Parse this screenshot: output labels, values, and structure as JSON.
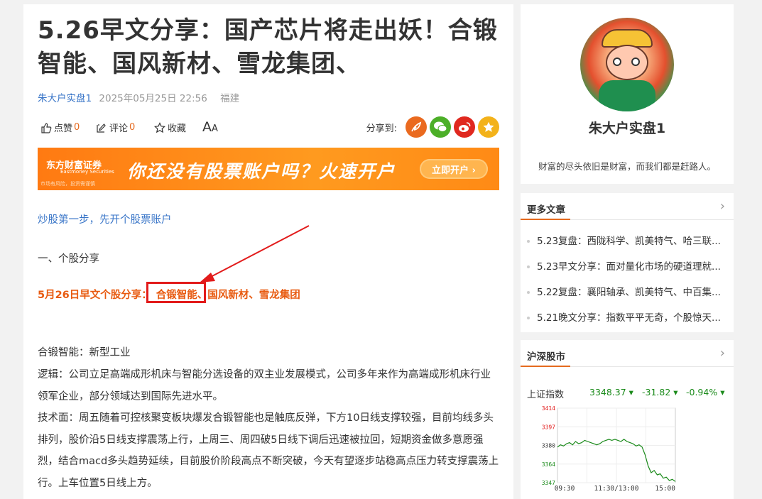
{
  "article": {
    "title_line1": "5.26早文分享：国产芯片将走出妖！合锻",
    "title_line2": "智能、国风新材、雪龙集团、",
    "author": "朱大户实盘1",
    "date": "2025年05月25日 22:56",
    "location": "福建",
    "like_label": "点赞",
    "like_count": "0",
    "comment_label": "评论",
    "comment_count": "0",
    "favorite_label": "收藏",
    "fontsize_label": "A",
    "fontsize_small": "A",
    "share_label": "分享到:",
    "link_text": "炒股第一步，先开个股票账户",
    "section1": "一、个股分享",
    "red_prefix": "5月26日早文个股分享：",
    "red_highlight": "合锻智能、",
    "red_rest": "国风新材、雪龙集团",
    "p_industry": "合锻智能：新型工业",
    "p_logic": "逻辑：公司立足高端成形机床与智能分选设备的双主业发展模式，公司多年来作为高端成形机床行业领军企业，部分领域达到国际先进水平。",
    "p_tech": "技术面：周五随着可控核聚变板块爆发合锻智能也是触底反弹，下方10日线支撑较强，目前均线多头排列，股价沿5日线支撑震荡上行，上周三、周四破5日线下调后迅速被拉回，短期资金做多意愿强烈，结合macd多头趋势延续，目前股价阶段高点不断突破，今天有望逐步站稳高点压力转支撑震荡上行。上车位置5日线上方。"
  },
  "banner": {
    "brand": "东方财富证券",
    "brand_sub": "Eastmoney Securities",
    "note": "市场有风险，投资需谨慎",
    "text": "你还没有股票账户吗？火速开户",
    "button": "立即开户 ›"
  },
  "profile": {
    "name": "朱大户实盘1",
    "desc": "财富的尽头依旧是财富，而我们都是赶路人。"
  },
  "more_articles": {
    "title": "更多文章",
    "items": [
      "5.23复盘：西陇科学、凯美特气、哈三联...",
      "5.23早文分享：面对量化市场的硬道理就...",
      "5.22复盘：襄阳轴承、凯美特气、中百集...",
      "5.21晚文分享：指数平平无奇，个股惊天..."
    ]
  },
  "stock_market": {
    "title": "沪深股市",
    "index_name": "上证指数",
    "index_value": "3348.37",
    "index_change": "-31.82",
    "index_pct": "-0.94%"
  },
  "chart_data": {
    "type": "line",
    "y_ticks": [
      "3414",
      "3397",
      "3380",
      "3364",
      "3347"
    ],
    "x_ticks": [
      "09:30",
      "11:30/13:00",
      "15:00"
    ],
    "ylim": [
      3347,
      3414
    ],
    "series": [
      {
        "values": [
          3379,
          3381,
          3380,
          3382,
          3383,
          3381,
          3384,
          3382,
          3383,
          3385,
          3384,
          3383,
          3382,
          3381,
          3382,
          3384,
          3385,
          3386,
          3385,
          3386,
          3385,
          3384,
          3386,
          3384,
          3383,
          3382,
          3380,
          3381,
          3379,
          3372,
          3362,
          3356,
          3358,
          3354,
          3355,
          3351,
          3352,
          3349,
          3350,
          3348
        ]
      }
    ],
    "colors": {
      "line": "#1a8a1a",
      "axis_up": "#e21b1b",
      "axis_down": "#1a8a1a"
    }
  },
  "icons": {
    "like": "thumb-icon",
    "comment": "edit-icon",
    "favorite": "star-icon",
    "share_weibo_colors": "#e56a1f",
    "wechat_color": "#4caf28",
    "weibo_color": "#e0281f",
    "qzone_color": "#f3b21a"
  }
}
